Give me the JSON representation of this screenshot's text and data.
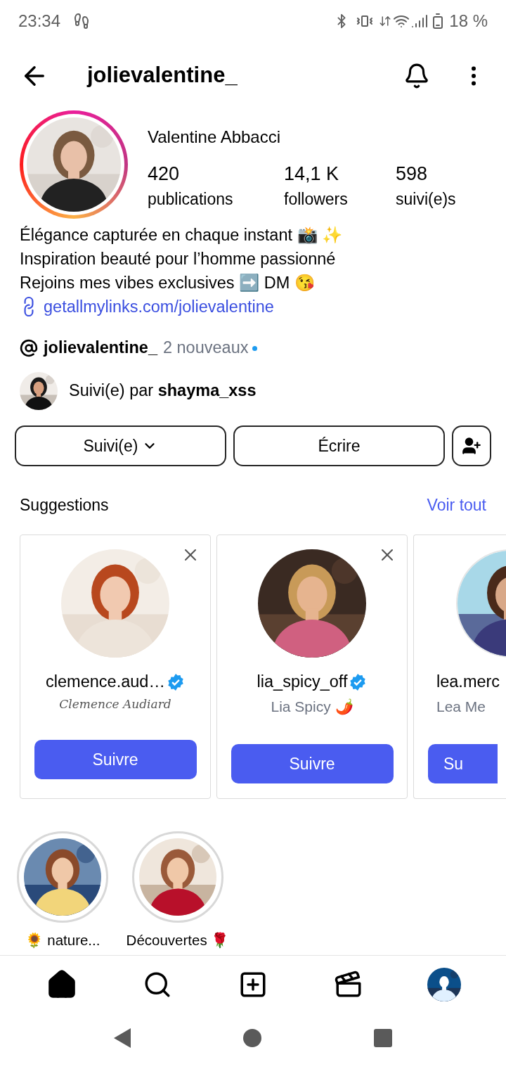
{
  "status_bar": {
    "time": "23:34",
    "battery": "18 %"
  },
  "header": {
    "username": "jolievalentine_"
  },
  "profile": {
    "name": "Valentine Abbacci",
    "stats": [
      {
        "value": "420",
        "label": "publications"
      },
      {
        "value": "14,1 K",
        "label": "followers"
      },
      {
        "value": "598",
        "label": "suivi(e)s"
      }
    ],
    "bio_lines": [
      "Élégance capturée en chaque instant 📸 ✨",
      "Inspiration beauté pour l’homme passionné",
      "Rejoins mes vibes exclusives ➡️ DM 😘"
    ],
    "link": "getallmylinks.com/jolievalentine",
    "threads": {
      "handle": "jolievalentine_",
      "badge": "2 nouveaux",
      "unread": true
    },
    "followed_by": {
      "prefix": "Suivi(e) par",
      "user": "shayma_xss"
    }
  },
  "actions": [
    {
      "kind": "dropdown",
      "label": "Suivi(e)"
    },
    {
      "kind": "plain",
      "label": "Écrire"
    },
    {
      "kind": "add_person"
    }
  ],
  "suggestions": {
    "title": "Suggestions",
    "see_all": "Voir tout",
    "cards": [
      {
        "kind": "full",
        "username": "clemence.aud…",
        "verified": true,
        "subtitle": {
          "kind": "script",
          "text": "Clemence Audiard"
        },
        "button": "Suivre"
      },
      {
        "kind": "full",
        "username": "lia_spicy_off",
        "verified": true,
        "subtitle": {
          "kind": "plain",
          "text": "Lia Spicy 🌶️"
        },
        "button": "Suivre"
      },
      {
        "kind": "cut",
        "username": "lea.merc",
        "subtitle": {
          "kind": "plain",
          "text": "Lea Me"
        },
        "button": "Su"
      }
    ]
  },
  "highlights": [
    {
      "label": "🌻 nature..."
    },
    {
      "label": "Découvertes 🌹"
    }
  ],
  "bottom_nav": [
    {
      "kind": "home",
      "selected": true
    },
    {
      "kind": "search",
      "selected": false
    },
    {
      "kind": "create",
      "selected": false
    },
    {
      "kind": "reels",
      "selected": false
    },
    {
      "kind": "profile",
      "selected": false
    }
  ]
}
